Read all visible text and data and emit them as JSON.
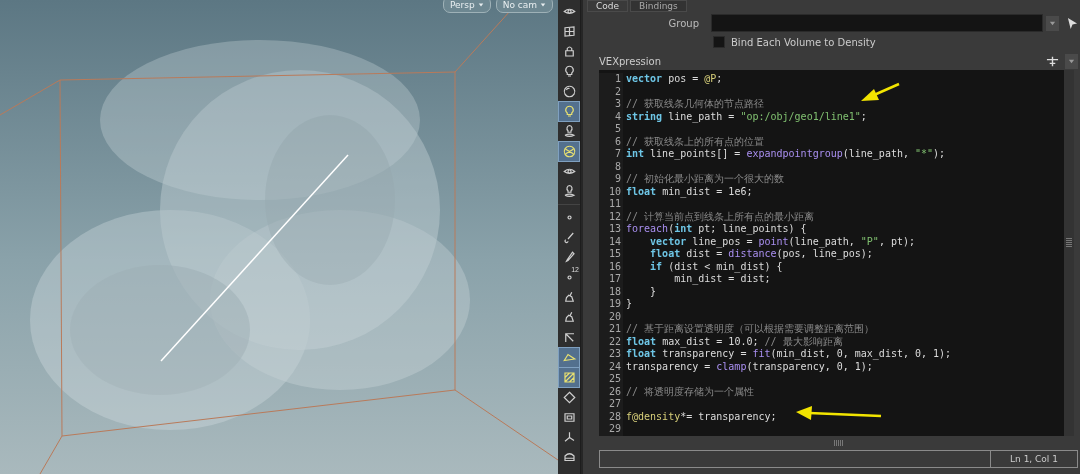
{
  "viewport": {
    "buttons": [
      {
        "label": "Persp"
      },
      {
        "label": "No cam"
      }
    ]
  },
  "toolbar": [
    {
      "kind": "eye",
      "selected": false
    },
    {
      "kind": "grid",
      "selected": false
    },
    {
      "kind": "lock",
      "selected": false
    },
    {
      "kind": "bulb",
      "selected": false
    },
    {
      "kind": "sphere",
      "selected": false
    },
    {
      "kind": "bulb",
      "selected": true
    },
    {
      "kind": "spot",
      "selected": false
    },
    {
      "kind": "ball",
      "selected": true
    },
    {
      "kind": "eye",
      "selected": false
    },
    {
      "kind": "spot",
      "selected": false
    },
    {
      "kind": "sep"
    },
    {
      "kind": "dot",
      "selected": false
    },
    {
      "kind": "brush",
      "selected": false
    },
    {
      "kind": "pin",
      "selected": false
    },
    {
      "kind": "dot",
      "selected": false,
      "label": "12"
    },
    {
      "kind": "paint",
      "selected": false
    },
    {
      "kind": "paint",
      "selected": false
    },
    {
      "kind": "frame",
      "selected": false
    },
    {
      "kind": "surface",
      "selected": true
    },
    {
      "kind": "check",
      "selected": true
    },
    {
      "kind": "diamond",
      "selected": false
    },
    {
      "kind": "box",
      "selected": false
    },
    {
      "kind": "axes",
      "selected": false
    },
    {
      "kind": "disk",
      "selected": false
    }
  ],
  "tabs": [
    {
      "label": "Code",
      "selected": true
    },
    {
      "label": "Bindings",
      "selected": false
    }
  ],
  "group": {
    "label": "Group"
  },
  "bind_each_volume": {
    "label": "Bind Each Volume to Density",
    "checked": false
  },
  "editor": {
    "label": "VEXpression",
    "lines": [
      {
        "number": "1",
        "tokens": [
          {
            "kind": "kw",
            "text": "vector"
          },
          {
            "kind": "plain",
            "text": " pos = "
          },
          {
            "kind": "attr",
            "text": "@P"
          },
          {
            "kind": "plain",
            "text": ";"
          }
        ]
      },
      {
        "number": "2"
      },
      {
        "number": "3",
        "tokens": [
          {
            "kind": "cmt",
            "text": "// 获取线条几何体的节点路径"
          }
        ]
      },
      {
        "number": "4",
        "tokens": [
          {
            "kind": "kw",
            "text": "string"
          },
          {
            "kind": "plain",
            "text": " line_path = "
          },
          {
            "kind": "str",
            "text": "\"op:/obj/geo1/line1\""
          },
          {
            "kind": "plain",
            "text": ";"
          }
        ]
      },
      {
        "number": "5"
      },
      {
        "number": "6",
        "tokens": [
          {
            "kind": "cmt",
            "text": "// 获取线条上的所有点的位置"
          }
        ]
      },
      {
        "number": "7",
        "tokens": [
          {
            "kind": "kw",
            "text": "int"
          },
          {
            "kind": "plain",
            "text": " line_points[] = "
          },
          {
            "kind": "fn",
            "text": "expandpointgroup"
          },
          {
            "kind": "plain",
            "text": "(line_path, "
          },
          {
            "kind": "str",
            "text": "\"*\""
          },
          {
            "kind": "plain",
            "text": ");"
          }
        ]
      },
      {
        "number": "8"
      },
      {
        "number": "9",
        "tokens": [
          {
            "kind": "cmt",
            "text": "// 初始化最小距离为一个很大的数"
          }
        ]
      },
      {
        "number": "10",
        "tokens": [
          {
            "kind": "kw",
            "text": "float"
          },
          {
            "kind": "plain",
            "text": " min_dist = 1e6;"
          }
        ]
      },
      {
        "number": "11"
      },
      {
        "number": "12",
        "tokens": [
          {
            "kind": "cmt",
            "text": "// 计算当前点到线条上所有点的最小距离"
          }
        ]
      },
      {
        "number": "13",
        "tokens": [
          {
            "kind": "fn",
            "text": "foreach"
          },
          {
            "kind": "plain",
            "text": "("
          },
          {
            "kind": "kw",
            "text": "int"
          },
          {
            "kind": "plain",
            "text": " pt; line_points) {"
          }
        ]
      },
      {
        "number": "14",
        "tokens": [
          {
            "kind": "kw",
            "text": "    vector"
          },
          {
            "kind": "plain",
            "text": " line_pos = "
          },
          {
            "kind": "fn",
            "text": "point"
          },
          {
            "kind": "plain",
            "text": "(line_path, "
          },
          {
            "kind": "str",
            "text": "\"P\""
          },
          {
            "kind": "plain",
            "text": ", pt);"
          }
        ]
      },
      {
        "number": "15",
        "tokens": [
          {
            "kind": "kw",
            "text": "    float"
          },
          {
            "kind": "plain",
            "text": " dist = "
          },
          {
            "kind": "fn",
            "text": "distance"
          },
          {
            "kind": "plain",
            "text": "(pos, line_pos);"
          }
        ]
      },
      {
        "number": "16",
        "tokens": [
          {
            "kind": "kw",
            "text": "    if"
          },
          {
            "kind": "plain",
            "text": " (dist < min_dist) {"
          }
        ]
      },
      {
        "number": "17",
        "tokens": [
          {
            "kind": "plain",
            "text": "        min_dist = dist;"
          }
        ]
      },
      {
        "number": "18",
        "tokens": [
          {
            "kind": "plain",
            "text": "    }"
          }
        ]
      },
      {
        "number": "19",
        "tokens": [
          {
            "kind": "plain",
            "text": "}"
          }
        ]
      },
      {
        "number": "20"
      },
      {
        "number": "21",
        "tokens": [
          {
            "kind": "cmt",
            "text": "// 基于距离设置透明度（可以根据需要调整距离范围）"
          }
        ]
      },
      {
        "number": "22",
        "tokens": [
          {
            "kind": "kw",
            "text": "float"
          },
          {
            "kind": "plain",
            "text": " max_dist = 10.0; "
          },
          {
            "kind": "cmt",
            "text": "// 最大影响距离"
          }
        ]
      },
      {
        "number": "23",
        "tokens": [
          {
            "kind": "kw",
            "text": "float"
          },
          {
            "kind": "plain",
            "text": " transparency = "
          },
          {
            "kind": "fn",
            "text": "fit"
          },
          {
            "kind": "plain",
            "text": "(min_dist, 0, max_dist, 0, 1);"
          }
        ]
      },
      {
        "number": "24",
        "tokens": [
          {
            "kind": "plain",
            "text": "transparency = "
          },
          {
            "kind": "fn",
            "text": "clamp"
          },
          {
            "kind": "plain",
            "text": "(transparency, 0, 1);"
          }
        ]
      },
      {
        "number": "25"
      },
      {
        "number": "26",
        "tokens": [
          {
            "kind": "cmt",
            "text": "// 将透明度存储为一个属性"
          }
        ]
      },
      {
        "number": "27"
      },
      {
        "number": "28",
        "tokens": [
          {
            "kind": "attr",
            "text": "f@density"
          },
          {
            "kind": "plain",
            "text": "*= transparency;"
          }
        ]
      },
      {
        "number": "29"
      }
    ]
  },
  "status": {
    "position": "Ln 1, Col 1"
  }
}
